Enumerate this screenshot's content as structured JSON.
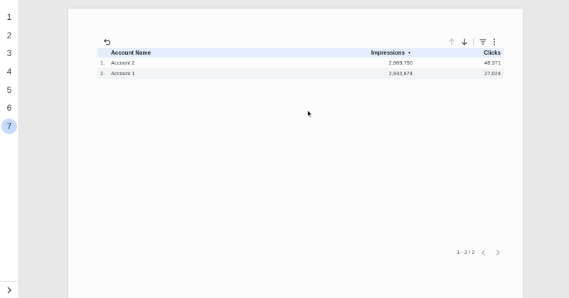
{
  "page_nav": {
    "pages": [
      "1",
      "2",
      "3",
      "4",
      "5",
      "6",
      "7"
    ],
    "active_page": "7"
  },
  "toolbar": {
    "icons": [
      "undo-icon",
      "arrow-up-icon",
      "arrow-down-icon",
      "filter-icon",
      "more-vert-icon"
    ]
  },
  "table": {
    "columns": [
      "Account Name",
      "Impressions",
      "Clicks"
    ],
    "sorted_column": "Impressions",
    "sort_direction": "descending",
    "rows": [
      {
        "num": "1.",
        "name": "Account 2",
        "impressions": "2,969,750",
        "clicks": "48,371"
      },
      {
        "num": "2.",
        "name": "Account 1",
        "impressions": "2,932,674",
        "clicks": "27,024"
      }
    ]
  },
  "pagination": {
    "label": "1 - 2 / 2"
  },
  "colors": {
    "header_bg": "#e3edfb",
    "active_page_bg": "#c6dafc",
    "alt_row_bg": "#f1f3f4"
  }
}
